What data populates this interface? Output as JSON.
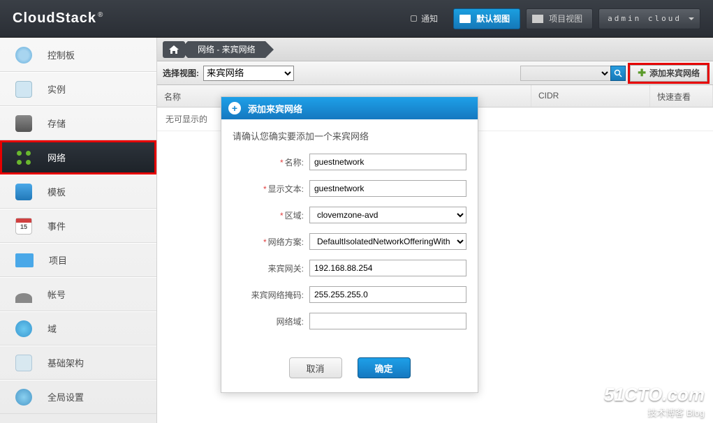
{
  "header": {
    "logo": "CloudStack",
    "notif_label": "通知",
    "view_default": "默认视图",
    "view_project": "项目视图",
    "user": "admin cloud"
  },
  "sidebar": {
    "items": [
      {
        "label": "控制板"
      },
      {
        "label": "实例"
      },
      {
        "label": "存储"
      },
      {
        "label": "网络"
      },
      {
        "label": "模板"
      },
      {
        "label": "事件"
      },
      {
        "label": "项目"
      },
      {
        "label": "帐号"
      },
      {
        "label": "域"
      },
      {
        "label": "基础架构"
      },
      {
        "label": "全局设置"
      }
    ]
  },
  "breadcrumb": {
    "seg": "网络 - 来宾网络"
  },
  "toolbar": {
    "select_view_label": "选择视图:",
    "select_view_value": "来宾网络",
    "add_button": "添加来宾网络"
  },
  "table": {
    "col_name": "名称",
    "col_cidr": "CIDR",
    "col_quickview": "快速查看",
    "empty": "无可显示的"
  },
  "modal": {
    "title": "添加来宾网络",
    "message": "请确认您确实要添加一个来宾网络",
    "labels": {
      "name": "名称:",
      "display": "显示文本:",
      "zone": "区域:",
      "offering": "网络方案:",
      "gateway": "来宾网关:",
      "netmask": "来宾网络掩码:",
      "domain": "网络域:"
    },
    "values": {
      "name": "guestnetwork",
      "display": "guestnetwork",
      "zone": "clovemzone-avd",
      "offering": "DefaultIsolatedNetworkOfferingWith",
      "gateway": "192.168.88.254",
      "netmask": "255.255.255.0",
      "domain": ""
    },
    "cancel": "取消",
    "ok": "确定"
  },
  "watermark": {
    "big": "51CTO.com",
    "small": "技术博客   Blog"
  }
}
